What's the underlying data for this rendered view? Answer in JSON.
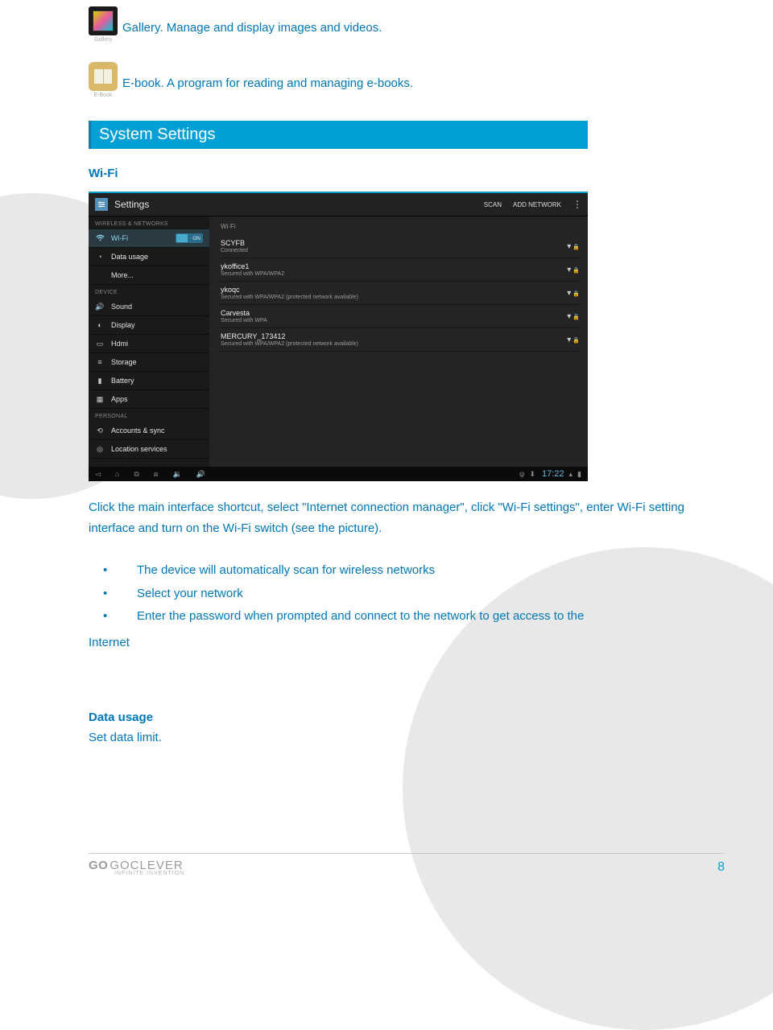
{
  "apps": {
    "gallery": {
      "caption": "Gallery",
      "text": "Gallery. Manage and display images and videos."
    },
    "ebook": {
      "caption": "E-Book",
      "text": "E-book. A program for reading and managing e-books."
    }
  },
  "section_banner": "System Settings",
  "wifi_heading": "Wi-Fi",
  "wifi_paragraph": "Click the main interface shortcut, select \"Internet connection manager\", click \"Wi-Fi settings\", enter Wi-Fi setting interface and turn on the Wi-Fi switch (see the picture).",
  "bullets": [
    "The device will automatically scan for wireless networks",
    "Select your network",
    "Enter the password when prompted and connect to the network to get access to the"
  ],
  "internet_word": "Internet",
  "data_usage": {
    "heading": "Data usage",
    "text": "Set data limit."
  },
  "footer": {
    "brand_go": "GO",
    "brand_clever": "GOCLEVER",
    "brand_sub": "INFINITE INVENTION",
    "page": "8"
  },
  "shot": {
    "header": {
      "title": "Settings",
      "scan": "SCAN",
      "add": "ADD NETWORK"
    },
    "side": {
      "cat_wireless": "WIRELESS & NETWORKS",
      "wifi": "Wi-Fi",
      "wifi_toggle": "ON",
      "data_usage": "Data usage",
      "more": "More...",
      "cat_device": "DEVICE",
      "sound": "Sound",
      "display": "Display",
      "hdmi": "Hdmi",
      "storage": "Storage",
      "battery": "Battery",
      "apps": "Apps",
      "cat_personal": "PERSONAL",
      "accounts": "Accounts & sync",
      "location": "Location services"
    },
    "main_title": "Wi-Fi",
    "networks": [
      {
        "name": "SCYFB",
        "sub": "Connected",
        "secured": true
      },
      {
        "name": "ykoffice1",
        "sub": "Secured with WPA/WPA2",
        "secured": true
      },
      {
        "name": "ykoqc",
        "sub": "Secured with WPA/WPA2 (protected network available)",
        "secured": true
      },
      {
        "name": "Carvesta",
        "sub": "Secured with WPA",
        "secured": true
      },
      {
        "name": "MERCURY_173412",
        "sub": "Secured with WPA/WPA2 (protected network available)",
        "secured": true
      }
    ],
    "clock": "17:22"
  }
}
